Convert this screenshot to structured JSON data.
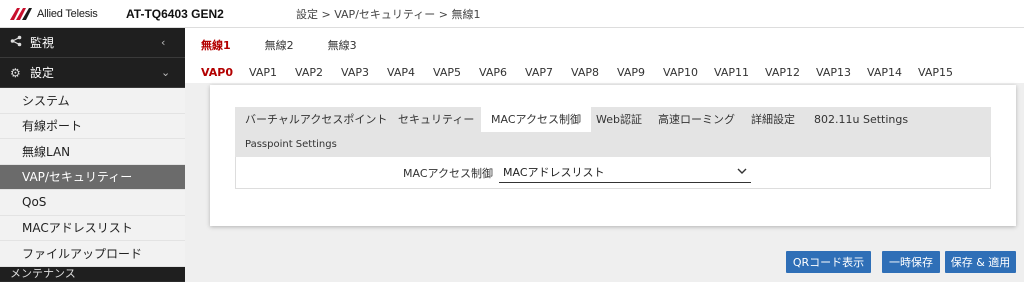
{
  "header": {
    "brand": "Allied Telesis",
    "model": "AT-TQ6403 GEN2",
    "breadcrumb": "設定 > VAP/セキュリティー > 無線1"
  },
  "sidebar": {
    "monitor_label": "監視",
    "settings_label": "設定",
    "items": [
      {
        "label": "システム"
      },
      {
        "label": "有線ポート"
      },
      {
        "label": "無線LAN"
      },
      {
        "label": "VAP/セキュリティー"
      },
      {
        "label": "QoS"
      },
      {
        "label": "MACアドレスリスト"
      },
      {
        "label": "ファイルアップロード"
      }
    ],
    "maintenance_label": "メンテナンス"
  },
  "radio_tabs": [
    {
      "label": "無線1"
    },
    {
      "label": "無線2"
    },
    {
      "label": "無線3"
    }
  ],
  "vap_tabs": [
    {
      "label": "VAP0"
    },
    {
      "label": "VAP1"
    },
    {
      "label": "VAP2"
    },
    {
      "label": "VAP3"
    },
    {
      "label": "VAP4"
    },
    {
      "label": "VAP5"
    },
    {
      "label": "VAP6"
    },
    {
      "label": "VAP7"
    },
    {
      "label": "VAP8"
    },
    {
      "label": "VAP9"
    },
    {
      "label": "VAP10"
    },
    {
      "label": "VAP11"
    },
    {
      "label": "VAP12"
    },
    {
      "label": "VAP13"
    },
    {
      "label": "VAP14"
    },
    {
      "label": "VAP15"
    }
  ],
  "sub_tabs": [
    {
      "label": "バーチャルアクセスポイント"
    },
    {
      "label": "セキュリティー"
    },
    {
      "label": "MACアクセス制御"
    },
    {
      "label": "Web認証"
    },
    {
      "label": "高速ローミング"
    },
    {
      "label": "詳細設定"
    },
    {
      "label": "802.11u Settings"
    },
    {
      "label": "Passpoint Settings"
    }
  ],
  "form": {
    "mac_access_label": "MACアクセス制御",
    "mac_access_value": "MACアドレスリスト"
  },
  "buttons": {
    "qr": "QRコード表示",
    "temp_save": "一時保存",
    "save_apply": "保存 & 適用"
  },
  "colors": {
    "accent": "#b30000",
    "button": "#2f6fb7",
    "sidebar_bg": "#2b2b2b"
  }
}
